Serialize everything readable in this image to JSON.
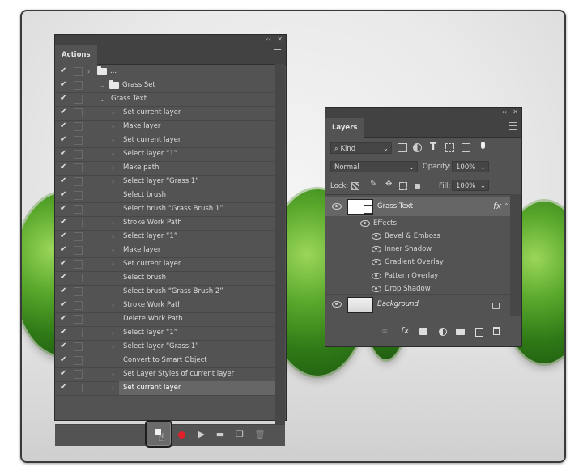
{
  "actions": {
    "tab": "Actions",
    "rows": [
      {
        "label": "...",
        "indent": 0,
        "type": "folder",
        "arrow": "›"
      },
      {
        "label": "Grass Set",
        "indent": 1,
        "type": "folder",
        "arrow": "⌄"
      },
      {
        "label": "Grass Text",
        "indent": 2,
        "type": "action",
        "arrow": "⌄"
      },
      {
        "label": "Set current layer",
        "indent": 3,
        "arrow": "›"
      },
      {
        "label": "Make layer",
        "indent": 3,
        "arrow": "›"
      },
      {
        "label": "Set current layer",
        "indent": 3,
        "arrow": "›"
      },
      {
        "label": "Select layer “1”",
        "indent": 3,
        "arrow": "›"
      },
      {
        "label": "Make path",
        "indent": 3,
        "arrow": "›"
      },
      {
        "label": "Select layer “Grass 1”",
        "indent": 3,
        "arrow": "›"
      },
      {
        "label": "Select brush",
        "indent": 3,
        "arrow": ""
      },
      {
        "label": "Select brush “Grass Brush 1”",
        "indent": 3,
        "arrow": ""
      },
      {
        "label": "Stroke Work Path",
        "indent": 3,
        "arrow": "›"
      },
      {
        "label": "Select layer “1”",
        "indent": 3,
        "arrow": "›"
      },
      {
        "label": "Make layer",
        "indent": 3,
        "arrow": "›"
      },
      {
        "label": "Set current layer",
        "indent": 3,
        "arrow": "›"
      },
      {
        "label": "Select brush",
        "indent": 3,
        "arrow": ""
      },
      {
        "label": "Select brush “Grass Brush 2”",
        "indent": 3,
        "arrow": ""
      },
      {
        "label": "Stroke Work Path",
        "indent": 3,
        "arrow": "›"
      },
      {
        "label": "Delete Work Path",
        "indent": 3,
        "arrow": ""
      },
      {
        "label": "Select layer “1”",
        "indent": 3,
        "arrow": "›"
      },
      {
        "label": "Select layer “Grass 1”",
        "indent": 3,
        "arrow": "›"
      },
      {
        "label": "Convert to Smart Object",
        "indent": 3,
        "arrow": ""
      },
      {
        "label": "Set Layer Styles of current layer",
        "indent": 3,
        "arrow": "›"
      },
      {
        "label": "Set current layer",
        "indent": 3,
        "arrow": "›",
        "selected": true
      }
    ],
    "check": "✔",
    "buttons": [
      "stop",
      "record",
      "play",
      "new-set",
      "new-action",
      "delete"
    ]
  },
  "layers": {
    "tab": "Layers",
    "filter": "Kind",
    "blend_mode": "Normal",
    "opacity_label": "Opacity:",
    "opacity": "100%",
    "lock_label": "Lock:",
    "fill_label": "Fill:",
    "fill": "100%",
    "layer1": {
      "name": "Grass Text",
      "fx": "fx"
    },
    "effects_label": "Effects",
    "effects": [
      "Bevel & Emboss",
      "Inner Shadow",
      "Gradient Overlay",
      "Pattern Overlay",
      "Drop Shadow"
    ],
    "layer2": {
      "name": "Background"
    },
    "bottom_fx": "fx"
  },
  "colors": {
    "panel": "#535353",
    "header": "#424242",
    "selected_row": "#666666",
    "record": "#e0202a"
  }
}
